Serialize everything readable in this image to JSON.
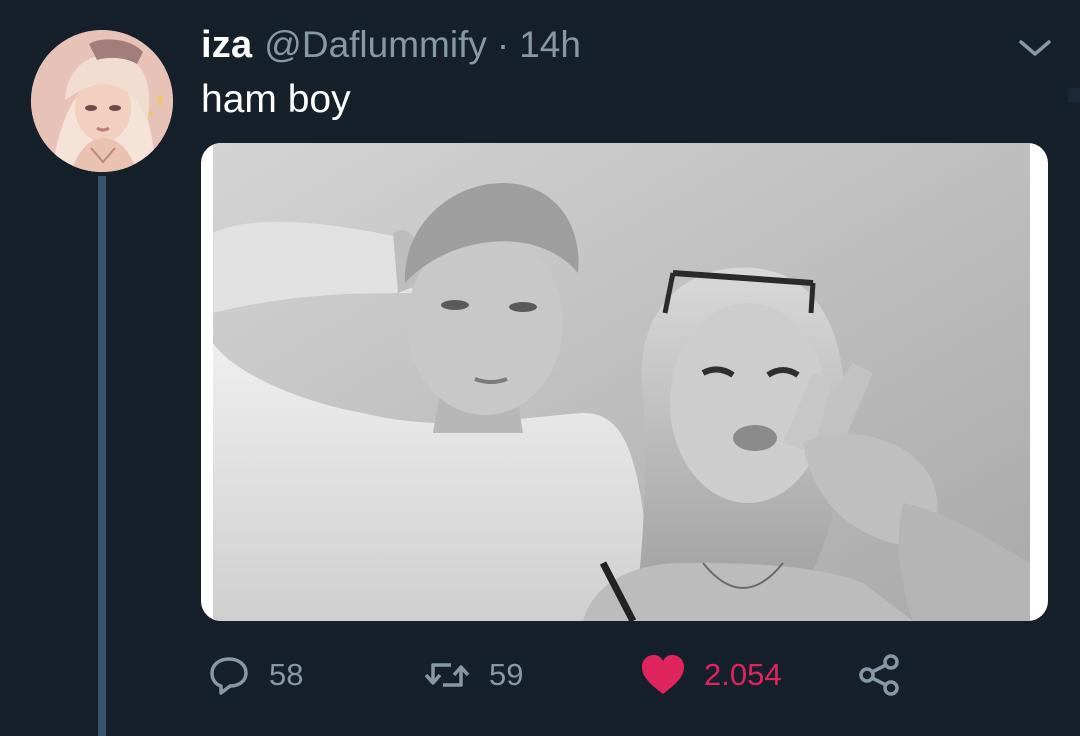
{
  "tweet": {
    "display_name": "iza",
    "handle": "@Daflummify",
    "separator": "·",
    "timestamp": "14h",
    "text": "ham boy",
    "avatar_icon": "avatar-illustration",
    "media_icon": "photo",
    "menu_icon": "chevron-down-icon"
  },
  "actions": {
    "reply": {
      "icon": "reply-icon",
      "count": "58"
    },
    "retweet": {
      "icon": "retweet-icon",
      "count": "59"
    },
    "like": {
      "icon": "heart-icon",
      "count": "2.054",
      "liked": true
    },
    "share": {
      "icon": "share-icon"
    }
  },
  "colors": {
    "background": "#15202b",
    "secondary_text": "#8899a6",
    "thread_line": "#38536b",
    "like_active": "#e0245e"
  }
}
